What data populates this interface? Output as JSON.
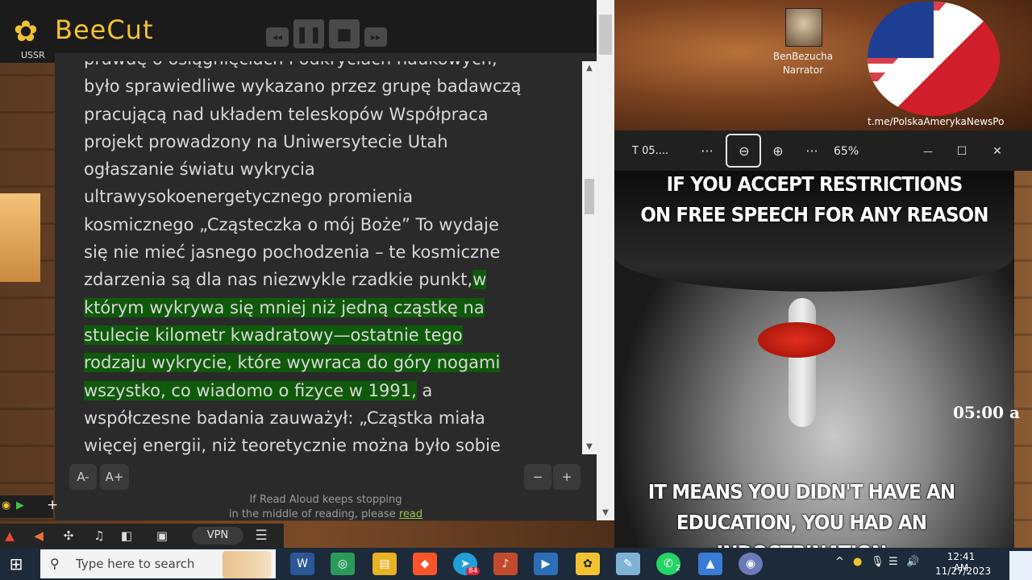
{
  "beecut": {
    "name": "BeeCut",
    "controls": {
      "rewind": "◂◂",
      "pause": "❚❚",
      "stop": "■",
      "forward": "▸▸"
    }
  },
  "background": {
    "ussr_label": "USSR"
  },
  "reader": {
    "text_lines": [
      "prawdę o osiągnięciach i odkryciach naukowych,",
      "było sprawiedliwe wykazano przez grupę badawczą",
      "pracującą nad układem teleskopów Współpraca",
      "projekt prowadzony na Uniwersytecie Utah",
      "ogłaszanie światu wykrycia",
      "ultrawysokoenergetycznego promienia",
      "kosmicznego „Cząsteczka o mój Boże” To wydaje",
      "się nie mieć jasnego pochodzenia – te kosmiczne",
      "zdarzenia są dla nas niezwykle rzadkie punkt,"
    ],
    "highlight_start": "w",
    "highlight_lines": [
      "którym wykrywa się mniej niż jedną cząstkę na",
      "stulecie kilometr kwadratowy—ostatnie tego",
      "rodzaju wykrycie, które wywraca do góry nogami",
      "wszystko, co wiadomo o fizyce w 1991,"
    ],
    "after_highlight": " a",
    "tail_lines": [
      "współczesne badania zauważył: „Cząstka miała",
      "więcej energii, niż teoretycznie można było sobie"
    ],
    "font_decrease": "A-",
    "font_increase": "A+",
    "speed_decrease": "−",
    "speed_increase": "+",
    "note_line1": "If Read Aloud keeps stopping",
    "note_line2": "in the middle of reading, please",
    "note_link": "read"
  },
  "narrator": {
    "name": "BenBezucha",
    "role": "Narrator"
  },
  "flag": {
    "caption": "t.me/PolskaAmerykaNewsPo"
  },
  "viewer": {
    "title": "T 05....",
    "more_left": "···",
    "zoom_out": "⊖",
    "zoom_in": "⊕",
    "more_right": "···",
    "zoom_level": "65%",
    "minimize": "—",
    "maximize": "☐",
    "close": "✕"
  },
  "meme": {
    "top_line1": "IF YOU ACCEPT RESTRICTIONS",
    "top_line2": "ON FREE SPEECH FOR ANY REASON",
    "bottom_line1": "IT MEANS YOU DIDN'T HAVE AN",
    "bottom_line2": "EDUCATION, YOU HAD AN INDOCTRINATION",
    "time_overlay": "05:00 a"
  },
  "extensions": {
    "vpn_label": "VPN"
  },
  "taskbar": {
    "search_placeholder": "Type here to search",
    "clock_time": "12:41 AM",
    "clock_date": "11/27/2023",
    "telegram_badge": "84",
    "whatsapp_badge": "2"
  },
  "colors": {
    "highlight": "#0f5a0a",
    "beecut_gold": "#f2c233",
    "taskbar": "#1c2a3a"
  }
}
